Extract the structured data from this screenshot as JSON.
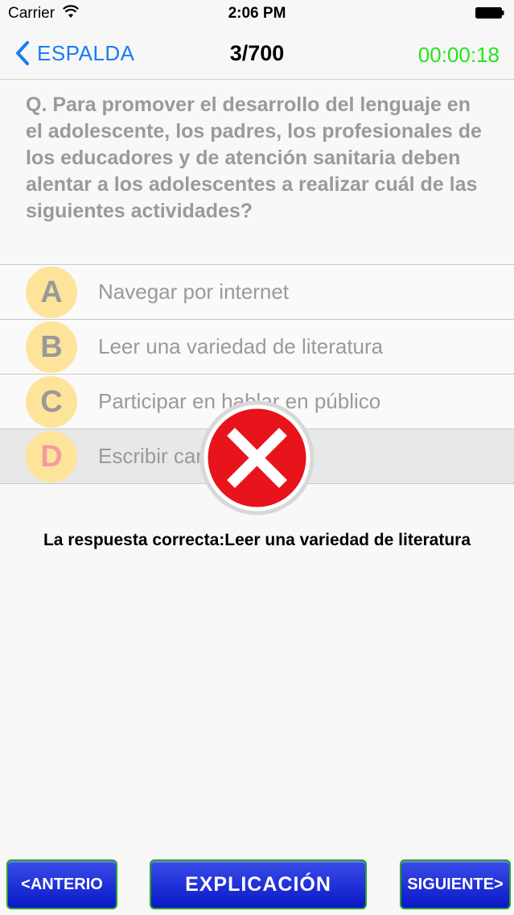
{
  "status_bar": {
    "carrier": "Carrier",
    "time": "2:06 PM"
  },
  "nav": {
    "back_label": "ESPALDA",
    "counter": "3/700",
    "timer": "00:00:18"
  },
  "question": {
    "text": "Q. Para promover el desarrollo del lenguaje en el adolescente, los padres, los profesionales de los educadores y de atención sanitaria deben alentar a los adolescentes a realizar cuál de las siguientes actividades?"
  },
  "options": [
    {
      "letter": "A",
      "text": "Navegar por internet"
    },
    {
      "letter": "B",
      "text": "Leer una variedad de literatura"
    },
    {
      "letter": "C",
      "text": "Participar en hablar en público"
    },
    {
      "letter": "D",
      "text": "Escribir cartas"
    }
  ],
  "result": {
    "answer_text": "La respuesta correcta:Leer una variedad de literatura"
  },
  "buttons": {
    "prev": "<ANTERIO",
    "explain": "EXPLICACIÓN",
    "next": "SIGUIENTE>"
  },
  "colors": {
    "accent": "#1a7cf2",
    "timer": "#22e61a",
    "button": "#0a18c8",
    "letter_bg": "#fde49a",
    "wrong": "#e8141c"
  }
}
